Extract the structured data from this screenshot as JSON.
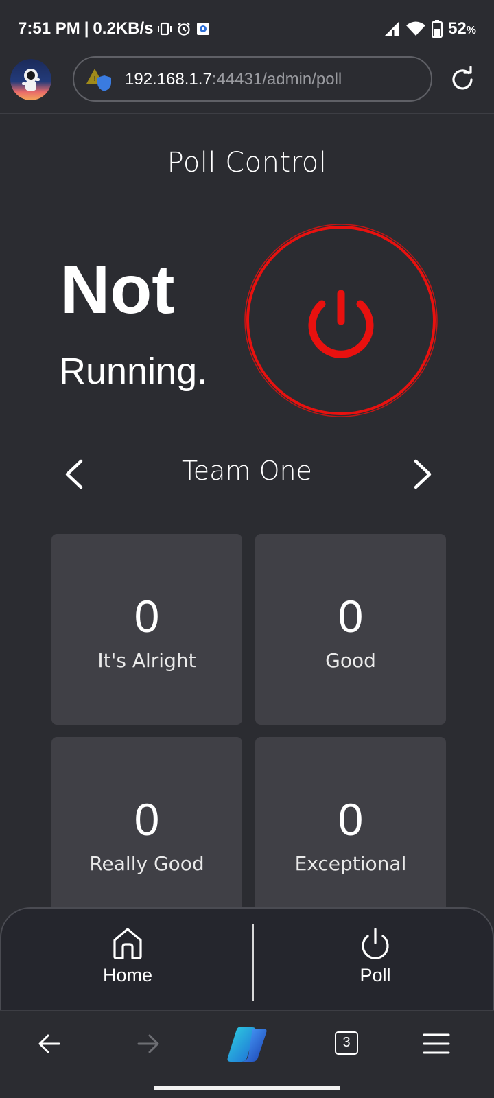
{
  "status_bar": {
    "time": "7:51 PM",
    "separator": "|",
    "speed": "0.2KB/s",
    "battery": "52",
    "battery_unit": "%"
  },
  "browser": {
    "url_host": "192.168.1.7",
    "url_path": ":44431/admin/poll",
    "tab_count": "3"
  },
  "page": {
    "title": "Poll Control",
    "status_line1": "Not",
    "status_line2": "Running.",
    "team_name": "Team One",
    "accent_color": "#e8110f",
    "cards": [
      {
        "value": "0",
        "label": "It's Alright"
      },
      {
        "value": "0",
        "label": "Good"
      },
      {
        "value": "0",
        "label": "Really Good"
      },
      {
        "value": "0",
        "label": "Exceptional"
      }
    ]
  },
  "nav": {
    "home_label": "Home",
    "poll_label": "Poll"
  }
}
